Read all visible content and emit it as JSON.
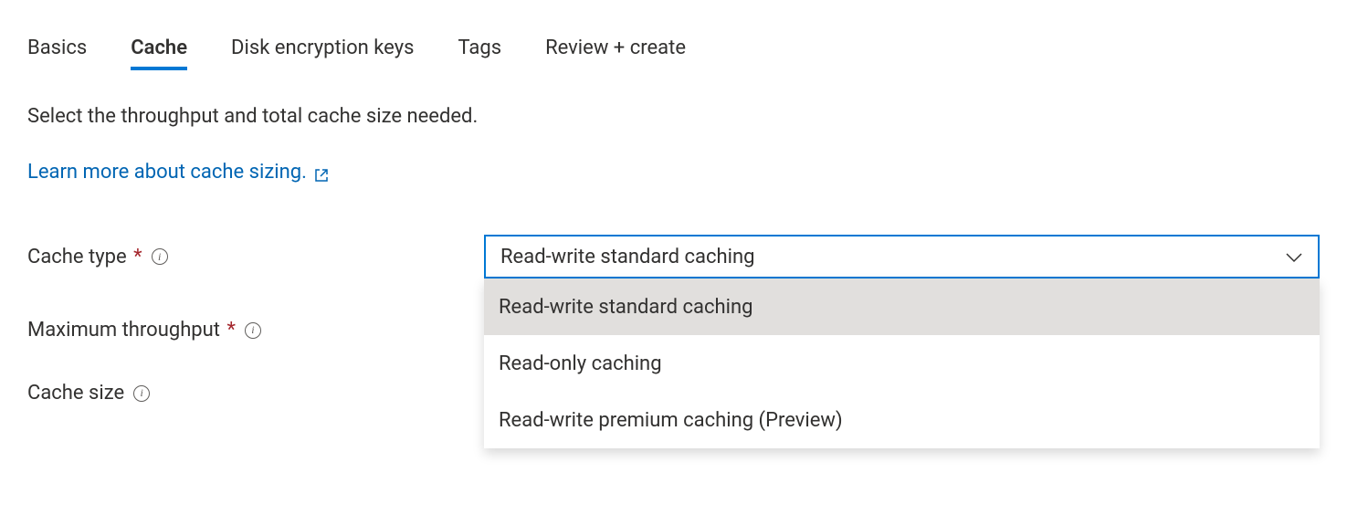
{
  "tabs": {
    "items": [
      {
        "label": "Basics",
        "active": false
      },
      {
        "label": "Cache",
        "active": true
      },
      {
        "label": "Disk encryption keys",
        "active": false
      },
      {
        "label": "Tags",
        "active": false
      },
      {
        "label": "Review + create",
        "active": false
      }
    ]
  },
  "description": "Select the throughput and total cache size needed.",
  "learn_more": {
    "text": "Learn more about cache sizing."
  },
  "form": {
    "cache_type": {
      "label": "Cache type",
      "required": true,
      "selected": "Read-write standard caching",
      "options": [
        "Read-write standard caching",
        "Read-only caching",
        "Read-write premium caching (Preview)"
      ]
    },
    "maximum_throughput": {
      "label": "Maximum throughput",
      "required": true
    },
    "cache_size": {
      "label": "Cache size",
      "required": false
    }
  }
}
